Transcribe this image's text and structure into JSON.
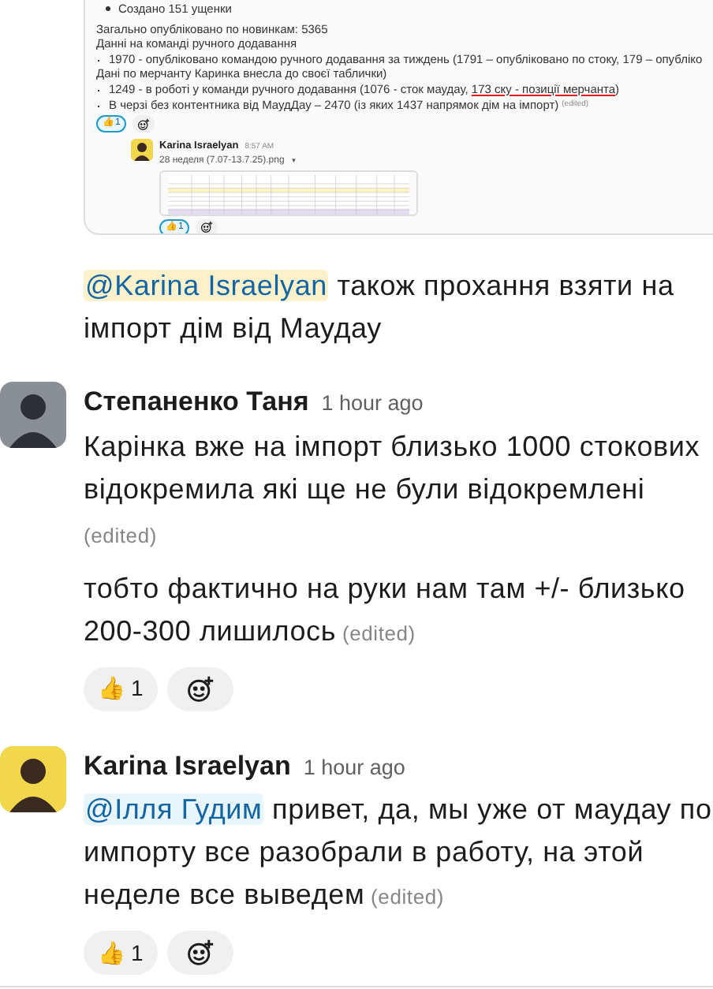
{
  "embedded_screenshot": {
    "lines": [
      {
        "kind": "bullet",
        "parts": [
          {
            "kind": "text",
            "text": "Создано 151 ущенки"
          }
        ]
      },
      {
        "kind": "gap_plain",
        "parts": [
          {
            "kind": "text",
            "text": "Загально опубліковано по новинкам: 5365"
          }
        ]
      },
      {
        "kind": "plain",
        "parts": [
          {
            "kind": "text",
            "text": "Данні на команді ручного додавання"
          }
        ]
      },
      {
        "kind": "dot",
        "parts": [
          {
            "kind": "text",
            "text": "1970 - опубліковано командою ручного додавання за тиждень (1791 – опубліковано по стоку, 179 – опубліко"
          }
        ]
      },
      {
        "kind": "plain",
        "parts": [
          {
            "kind": "text",
            "text": "Дані по мерчанту Каринка внесла до своєї таблички)"
          }
        ]
      },
      {
        "kind": "dot",
        "parts": [
          {
            "kind": "text",
            "text": "1249 - в роботі у команди ручного додавання (1076 - сток маудау, "
          },
          {
            "kind": "underline",
            "text": "173 ску - позиції мерчанта"
          },
          {
            "kind": "text",
            "text": ")"
          }
        ]
      },
      {
        "kind": "dot",
        "parts": [
          {
            "kind": "text",
            "text": "В черзі без контентника від МаудДау – 2470 (із яких 1437 напрямок дім на імпорт)"
          }
        ],
        "edited_label": "(edited)"
      }
    ],
    "reactions": [
      {
        "kind": "emoji",
        "emoji": "👍",
        "count": "1",
        "selected": true
      },
      {
        "kind": "add"
      }
    ],
    "message": {
      "author": "Karina Israelyan",
      "time": "8:57 AM",
      "file_name": "28 неделя (7.07-13.7.25).png",
      "caret": "▼",
      "reactions": [
        {
          "kind": "emoji",
          "emoji": "👍",
          "count": "1",
          "selected": true
        },
        {
          "kind": "add"
        }
      ]
    }
  },
  "messages": [
    {
      "paragraphs": [
        {
          "parts": [
            {
              "kind": "mention_self",
              "text": "@Karina Israelyan"
            },
            {
              "kind": "text",
              "text": " також прохання взяти на імпорт дім від Маудау"
            }
          ]
        }
      ]
    },
    {
      "author": "Степаненко Таня",
      "time": "1 hour ago",
      "paragraphs": [
        {
          "parts": [
            {
              "kind": "text",
              "text": "Карінка вже на імпорт близько 1000 стокових відокремила які ще не були відокремлені"
            }
          ],
          "edited_label": "(edited)"
        },
        {
          "parts": [
            {
              "kind": "text",
              "text": "тобто фактично на руки нам там +/- близько 200-300 лишилось"
            }
          ],
          "edited_label": "(edited)"
        }
      ],
      "reactions": [
        {
          "kind": "emoji",
          "emoji": "👍",
          "count": "1",
          "selected": false
        },
        {
          "kind": "add"
        }
      ]
    },
    {
      "author": "Karina Israelyan",
      "time": "1 hour ago",
      "paragraphs": [
        {
          "parts": [
            {
              "kind": "mention",
              "text": "@Ілля Гудим"
            },
            {
              "kind": "text",
              "text": " привет, да, мы уже от маудау по импорту все разобрали в работу, на этой неделе все выведем"
            }
          ],
          "edited_label": "(edited)"
        }
      ],
      "reactions": [
        {
          "kind": "emoji",
          "emoji": "👍",
          "count": "1",
          "selected": false
        },
        {
          "kind": "add"
        }
      ]
    }
  ]
}
